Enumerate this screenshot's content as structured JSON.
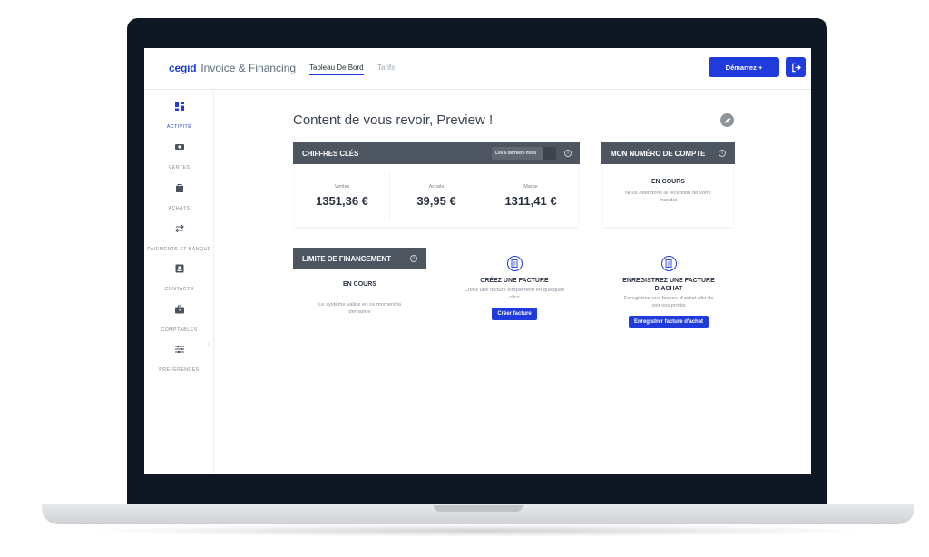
{
  "header": {
    "brand_name": "cegid",
    "product_name": "Invoice & Financing",
    "tabs": [
      {
        "label": "Tableau De Bord",
        "active": true
      },
      {
        "label": "Tarifs",
        "active": false
      }
    ],
    "start_button": "Démarrez +",
    "logout_icon": "logout-icon"
  },
  "sidebar": {
    "items": [
      {
        "label": "ACTIVITÉ",
        "icon": "dashboard-grid-icon",
        "active": true
      },
      {
        "label": "VENTES",
        "icon": "money-icon",
        "active": false
      },
      {
        "label": "ACHATS",
        "icon": "shopping-bag-icon",
        "active": false
      },
      {
        "label": "PAIEMENTS ET BANQUE",
        "icon": "transfer-arrows-icon",
        "active": false
      },
      {
        "label": "CONTACTS",
        "icon": "contact-card-icon",
        "active": false
      },
      {
        "label": "COMPTABLES",
        "icon": "briefcase-icon",
        "active": false
      },
      {
        "label": "PRÉFÉRENCES",
        "icon": "sliders-icon",
        "active": false
      }
    ]
  },
  "main": {
    "greeting": "Content de vous revoir, Preview !",
    "key_figures": {
      "title": "CHIFFRES CLÉS",
      "period": "Les 6 derniers mois",
      "items": [
        {
          "label": "Ventes",
          "value": "1351,36 €"
        },
        {
          "label": "Achats",
          "value": "39,95 €"
        },
        {
          "label": "Marge",
          "value": "1311,41 €"
        }
      ]
    },
    "account_number": {
      "title": "MON NUMÉRO DE COMPTE",
      "status": "EN COURS",
      "text": "Nous attendons la réception de votre mandat"
    },
    "financing_limit": {
      "title": "LIMITE DE FINANCEMENT",
      "status": "EN COURS",
      "text": "Le système valide en ce moment la demande"
    },
    "create_invoice": {
      "title": "CRÉEZ UNE FACTURE",
      "text": "Créez une facture simplement en quelques clics",
      "button": "Créer facture"
    },
    "register_purchase": {
      "title": "ENREGISTREZ UNE FACTURE D'ACHAT",
      "text": "Enregistrez une facture d'achat afin de voir vos profits",
      "button": "Enregistrer facture d'achat"
    },
    "info_symbol": "i"
  },
  "colors": {
    "accent": "#1f3bdb",
    "card_header": "#4d5561",
    "laptop_bezel": "#0e1825"
  }
}
